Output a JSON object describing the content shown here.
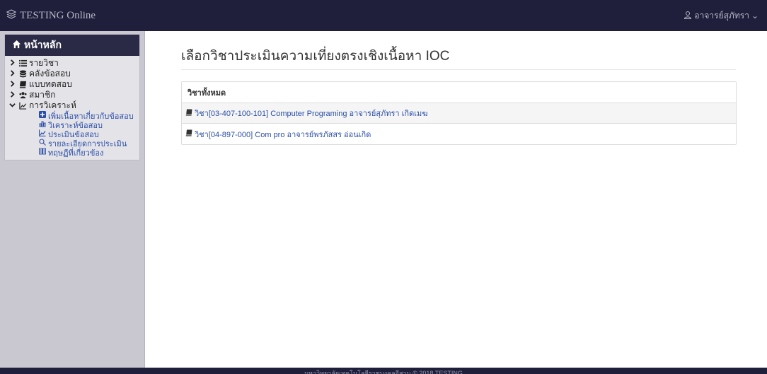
{
  "app": {
    "title": "TESTING Online"
  },
  "user": {
    "name": "อาจารย์สุภัทรา",
    "caret": "⌄"
  },
  "sidebar": {
    "home_label": "หน้าหลัก",
    "items": [
      {
        "label": "รายวิชา",
        "chevron": "right",
        "icon": "list-icon"
      },
      {
        "label": "คลังข้อสอบ",
        "chevron": "right",
        "icon": "database-icon"
      },
      {
        "label": "แบบทดสอบ",
        "chevron": "right",
        "icon": "book-icon"
      },
      {
        "label": "สมาชิก",
        "chevron": "right",
        "icon": "users-icon"
      },
      {
        "label": "การวิเคราะห์",
        "chevron": "down",
        "icon": "line-chart-icon"
      }
    ],
    "subitems": [
      {
        "label": "เพิ่มเนื้อหาเกี่ยวกับข้อสอบ",
        "icon": "plus-square-icon"
      },
      {
        "label": "วิเคราะห์ข้อสอบ",
        "icon": "bar-chart-icon"
      },
      {
        "label": "ประเมินข้อสอบ",
        "icon": "line-chart-icon"
      },
      {
        "label": "รายละเอียดการประเมิน",
        "icon": "search-icon"
      },
      {
        "label": "ทฤษฏีที่เกี่ยวข้อง",
        "icon": "open-book-icon"
      }
    ]
  },
  "main": {
    "title": "เลือกวิชาประเมินความเที่ยงตรงเชิงเนื้อหา IOC",
    "panel_header": "วิชาทั้งหมด",
    "courses": [
      {
        "label": "วิชา[03-407-100-101] Computer Programing อาจารย์สุภัทรา เกิดเมฆ"
      },
      {
        "label": "วิชา[04-897-000] Com pro อาจารย์พรภัสสร อ่อนเกิด"
      }
    ]
  },
  "footer": {
    "text": "มหาวิทยาลัยเทคโนโลยีราชมงคลอีสาน © 2018 TESTING"
  },
  "colors": {
    "topbar": "#1f1e3b",
    "sidebar": "#c9c7d0",
    "link": "#2b4fa8",
    "home": "#2a2946"
  }
}
